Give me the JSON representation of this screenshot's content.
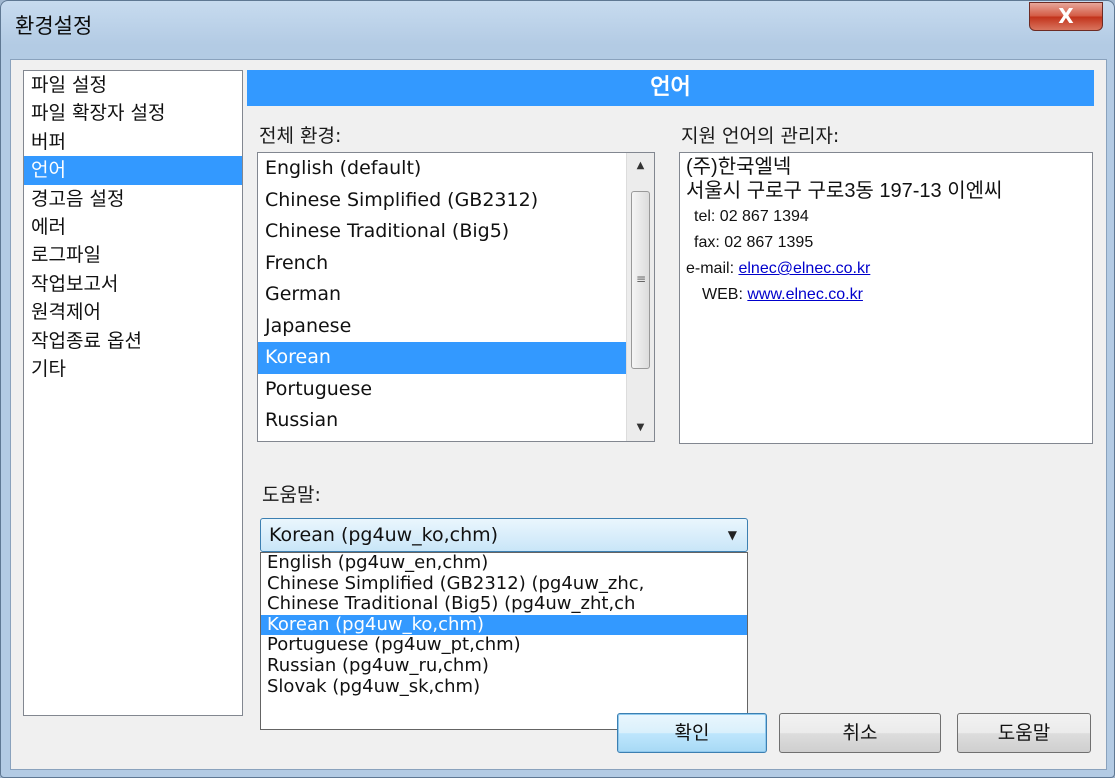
{
  "window": {
    "title": "환경설정",
    "close_label": "X"
  },
  "nav": {
    "items": [
      "파일 설정",
      "파일 확장자 설정",
      "버퍼",
      "언어",
      "경고음 설정",
      "에러",
      "로그파일",
      "작업보고서",
      "원격제어",
      "작업종료 옵션",
      "기타"
    ],
    "selected": "언어"
  },
  "panel": {
    "header": "언어",
    "environment_label": "전체 환경:",
    "admin_label": "지원 언어의 관리자:",
    "help_label": "도움말:"
  },
  "languages": {
    "items": [
      "English  (default)",
      "Chinese Simplified (GB2312)",
      "Chinese Traditional (Big5)",
      "French",
      "German",
      "Japanese",
      "Korean",
      "Portuguese",
      "Russian"
    ],
    "selected": "Korean"
  },
  "admin": {
    "company": "(주)한국엘넥",
    "address": "서울시 구로구 구로3동 197-13 이엔씨",
    "tel": "tel:  02 867 1394",
    "fax": "fax: 02 867 1395",
    "email_label": "e-mail:",
    "email": "elnec@elnec.co.kr",
    "web_label": "WEB:",
    "web": "www.elnec.co.kr"
  },
  "help": {
    "selected": "Korean  (pg4uw_ko,chm)",
    "options": [
      "English  (pg4uw_en,chm)",
      "Chinese Simplified (GB2312)  (pg4uw_zhc,",
      "Chinese Traditional (Big5)  (pg4uw_zht,ch",
      "Korean  (pg4uw_ko,chm)",
      "Portuguese  (pg4uw_pt,chm)",
      "Russian  (pg4uw_ru,chm)",
      "Slovak  (pg4uw_sk,chm)"
    ]
  },
  "buttons": {
    "ok": "확인",
    "cancel": "취소",
    "help": "도움말"
  }
}
